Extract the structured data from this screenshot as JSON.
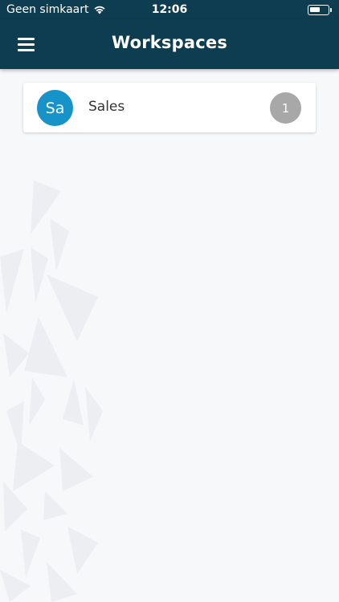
{
  "status_bar": {
    "carrier": "Geen simkaart",
    "time": "12:06",
    "wifi_icon": "wifi-icon",
    "battery_icon": "battery-icon"
  },
  "app_bar": {
    "title": "Workspaces",
    "menu_icon": "hamburger-menu-icon"
  },
  "workspaces": [
    {
      "initials": "Sa",
      "name": "Sales",
      "count": "1",
      "avatar_color": "#1693c9"
    }
  ],
  "colors": {
    "header_bg": "#0e3d52",
    "page_bg": "#f7f8fa",
    "badge_bg": "#a8a8a8"
  }
}
